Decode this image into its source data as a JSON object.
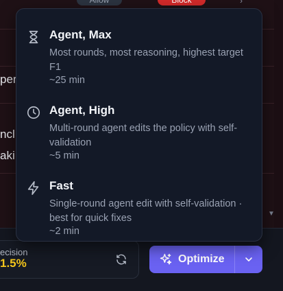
{
  "background": {
    "pills": {
      "allow": "Allow",
      "block": "Block"
    },
    "fragments": [
      "pera",
      "ncl",
      "aki"
    ],
    "metric": {
      "label": "ecision",
      "value": "1.5%"
    }
  },
  "optimize": {
    "label": "Optimize"
  },
  "menu": {
    "items": [
      {
        "title": "Agent, Max",
        "description": "Most rounds, most reasoning, highest target F1",
        "time": "~25 min",
        "icon": "hourglass-icon"
      },
      {
        "title": "Agent, High",
        "description": "Multi-round agent edits the policy with self-validation",
        "time": "~5 min",
        "icon": "clock-icon"
      },
      {
        "title": "Fast",
        "description": "Single-round agent edit with self-validation · best for quick fixes",
        "time": "~2 min",
        "icon": "lightning-icon"
      }
    ]
  },
  "colors": {
    "accent": "#6a62f2",
    "block": "#d42a2a",
    "metric": "#f3c51c"
  }
}
